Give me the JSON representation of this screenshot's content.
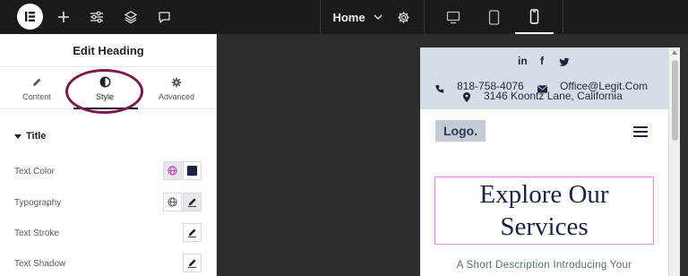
{
  "topbar": {
    "logo_icon": "elementor-logo-icon",
    "page_name": "Home",
    "icons": [
      "plus-icon",
      "sliders-icon",
      "layers-icon",
      "comment-icon",
      "chevron-down-icon",
      "gear-icon",
      "desktop-icon",
      "tablet-icon",
      "mobile-icon"
    ],
    "active_device": "mobile"
  },
  "panel": {
    "title": "Edit Heading",
    "tabs": [
      {
        "label": "Content",
        "icon": "pencil-icon"
      },
      {
        "label": "Style",
        "icon": "half-circle-icon"
      },
      {
        "label": "Advanced",
        "icon": "gear-icon"
      }
    ],
    "active_tab": "Style",
    "section_title": "Title",
    "controls": [
      {
        "label": "Text Color"
      },
      {
        "label": "Typography"
      },
      {
        "label": "Text Stroke"
      },
      {
        "label": "Text Shadow"
      }
    ],
    "highlight_color": "#7a1a4a"
  },
  "preview": {
    "phone": "818-758-4076",
    "email": "Office@Legit.Com",
    "address": "3146 Koontz Lane, California",
    "social": [
      "in",
      "f",
      "twitter-icon"
    ],
    "logo": "Logo.",
    "heading": "Explore Our Services",
    "description": "A Short Description Introducing Your",
    "heading_color": "#1a2440",
    "accent_border": "#e58ee3"
  }
}
